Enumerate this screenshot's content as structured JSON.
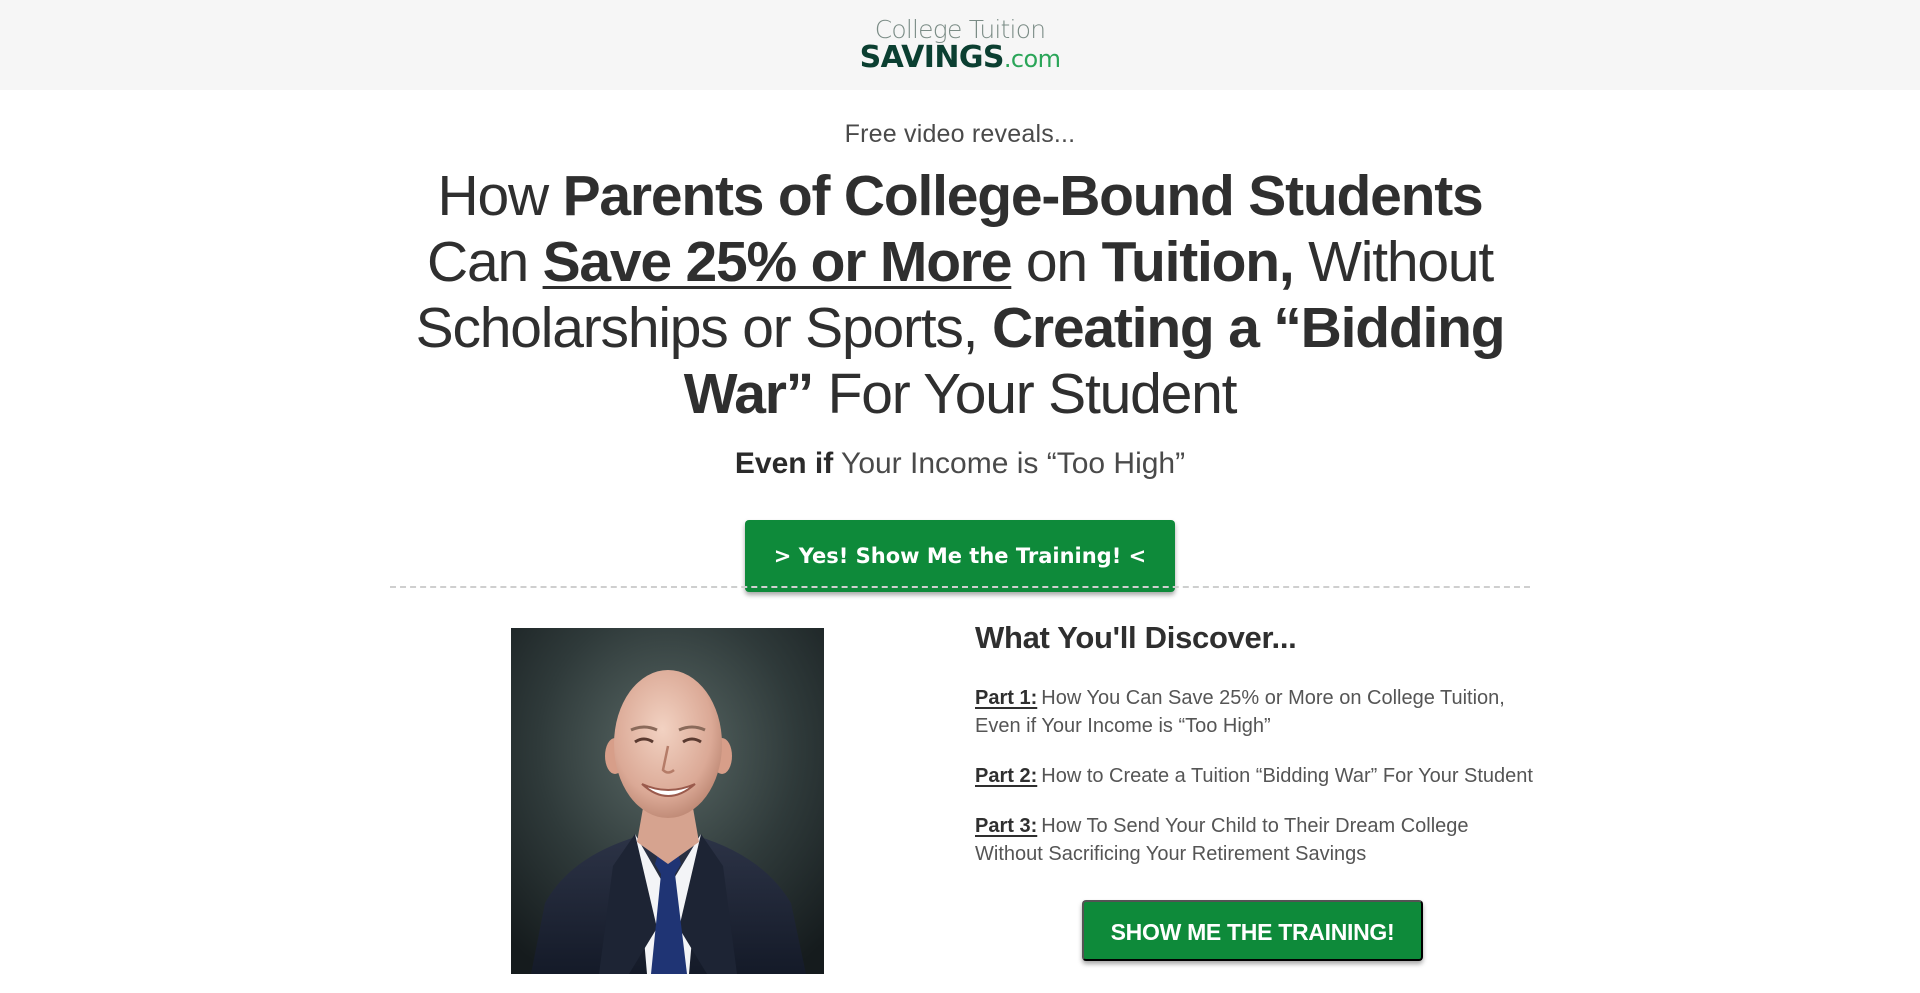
{
  "header": {
    "logo": {
      "line1": "College Tuition",
      "line2_main": "SAVINGS",
      "line2_suffix": ".com"
    }
  },
  "hero": {
    "eyebrow": "Free video reveals...",
    "headline": {
      "p1": "How ",
      "p2": "Parents of College-Bound Students",
      "p3": " Can ",
      "p4": "Save 25% or More",
      "p5": " on ",
      "p6": "Tuition,",
      "p7": " Without Scholarships or Sports, ",
      "p8": "Creating a “Bidding War”",
      "p9": " For Your Student"
    },
    "subhead": {
      "bold": "Even if",
      "rest": " Your Income is “Too High”"
    },
    "cta_label": "> Yes! Show Me the Training! <"
  },
  "discover": {
    "title": "What You'll Discover...",
    "parts": [
      {
        "label": "Part 1:",
        "text": "How You Can Save 25% or More on College Tuition, Even if Your Income is “Too High”"
      },
      {
        "label": "Part 2:",
        "text": "How to Create a Tuition “Bidding War” For Your Student"
      },
      {
        "label": "Part 3:",
        "text": "How To Send Your Child to Their Dream College Without Sacrificing Your Retirement Savings"
      }
    ],
    "cta_label": "SHOW ME THE TRAINING!"
  },
  "colors": {
    "brand_green": "#0e8a3a",
    "header_bg": "#f6f6f6",
    "text_dark": "#2f2f2f"
  }
}
